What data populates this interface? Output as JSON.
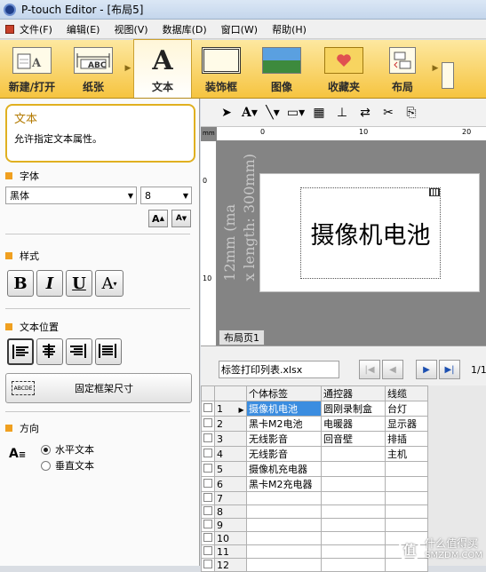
{
  "window": {
    "title": "P-touch Editor - [布局5]"
  },
  "menu": [
    "文件(F)",
    "编辑(E)",
    "视图(V)",
    "数据库(D)",
    "窗口(W)",
    "帮助(H)"
  ],
  "ribbon": [
    {
      "label": "新建/打开",
      "icon": "new-open-icon",
      "active": false
    },
    {
      "label": "纸张",
      "icon": "paper-icon",
      "active": false
    },
    {
      "label": "文本",
      "icon": "text-A-icon",
      "active": true
    },
    {
      "label": "装饰框",
      "icon": "frame-icon",
      "active": false
    },
    {
      "label": "图像",
      "icon": "image-icon",
      "active": false
    },
    {
      "label": "收藏夹",
      "icon": "favorites-icon",
      "active": false
    },
    {
      "label": "布局",
      "icon": "layout-icon",
      "active": false
    }
  ],
  "panel": {
    "desc_title": "文本",
    "desc_text": "允许指定文本属性。",
    "font_section": "字体",
    "font_name": "黑体",
    "font_size": "8",
    "style_section": "样式",
    "style_buttons": [
      "B",
      "I",
      "U",
      "A"
    ],
    "position_section": "文本位置",
    "fix_frame_label": "固定框架尺寸",
    "fix_frame_icon_text": "ABCDE",
    "direction_section": "方向",
    "horizontal_label": "水平文本",
    "vertical_label": "垂直文本",
    "horizontal_selected": true
  },
  "canvas": {
    "label_text": "摄像机电池",
    "size_label_1": "12mm (ma",
    "size_label_2": "x length: 300mm)",
    "page_tab": "布局页1",
    "ruler_marks": [
      "0",
      "10",
      "20"
    ]
  },
  "database": {
    "file": "标签打印列表.xlsx",
    "record_info": "1/12",
    "columns": [
      "个体标签",
      "通控器",
      "线缆"
    ],
    "rows": [
      [
        "1",
        "摄像机电池",
        "圆刚录制盒",
        "台灯"
      ],
      [
        "2",
        "黑卡M2电池",
        "电暖器",
        "显示器"
      ],
      [
        "3",
        "无线影音",
        "回音壁",
        "排插"
      ],
      [
        "4",
        "无线影音",
        "",
        "主机"
      ],
      [
        "5",
        "摄像机充电器",
        "",
        ""
      ],
      [
        "6",
        "黑卡M2充电器",
        "",
        ""
      ],
      [
        "7",
        "",
        "",
        ""
      ],
      [
        "8",
        "",
        "",
        ""
      ],
      [
        "9",
        "",
        "",
        ""
      ],
      [
        "10",
        "",
        "",
        ""
      ],
      [
        "11",
        "",
        "",
        ""
      ],
      [
        "12",
        "",
        "",
        ""
      ]
    ]
  },
  "watermark": {
    "text1": "什么值得买",
    "text2": "SMZDM.COM",
    "logo": "值"
  }
}
